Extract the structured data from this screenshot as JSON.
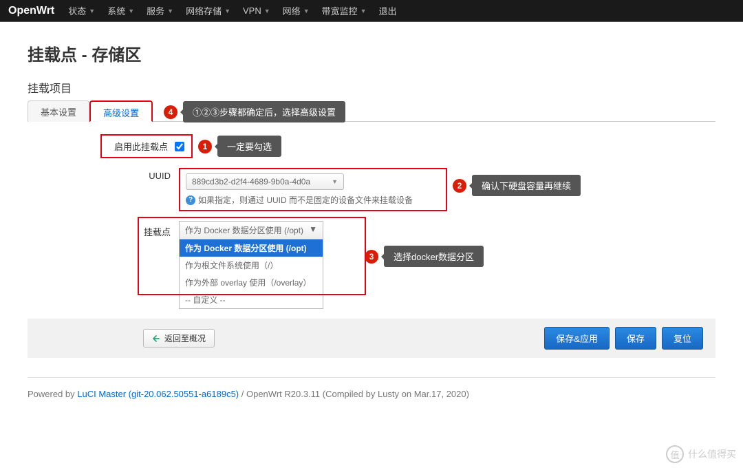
{
  "nav": {
    "brand": "OpenWrt",
    "items": [
      "状态",
      "系统",
      "服务",
      "网络存储",
      "VPN",
      "网络",
      "带宽监控",
      "退出"
    ]
  },
  "page": {
    "title": "挂载点 - 存储区",
    "legend": "挂载项目"
  },
  "tabs": {
    "basic": "基本设置",
    "advanced": "高级设置"
  },
  "annotations": {
    "step4": "①②③步骤都确定后，选择高级设置",
    "step1": "一定要勾选",
    "step2": "确认下硬盘容量再继续",
    "step3": "选择docker数据分区"
  },
  "form": {
    "enable_label": "启用此挂载点",
    "uuid_label": "UUID",
    "uuid_value": "889cd3b2-d2f4-4689-9b0a-4d0a",
    "uuid_hint": "如果指定，则通过 UUID 而不是固定的设备文件来挂载设备",
    "mount_label": "挂载点",
    "mount_selected": "作为 Docker 数据分区使用 (/opt)",
    "mount_options": [
      "作为 Docker 数据分区使用 (/opt)",
      "作为根文件系统使用（/）",
      "作为外部 overlay 使用（/overlay）",
      "-- 自定义 --"
    ]
  },
  "buttons": {
    "back": "返回至概况",
    "save_apply": "保存&应用",
    "save": "保存",
    "reset": "复位"
  },
  "footer": {
    "prefix": "Powered by ",
    "link": "LuCI Master (git-20.062.50551-a6189c5)",
    "suffix": " / OpenWrt R20.3.11 (Compiled by Lusty on Mar.17, 2020)"
  },
  "watermark": {
    "char": "值",
    "text": "什么值得买"
  }
}
